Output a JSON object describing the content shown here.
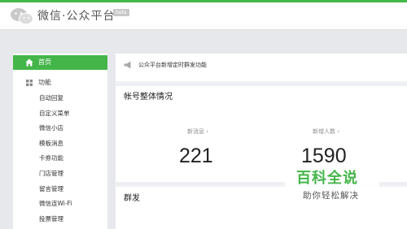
{
  "header": {
    "brand": "微信·公众平台",
    "beta": "beta"
  },
  "sidebar": {
    "home_label": "首页",
    "group_label": "功能",
    "items": [
      {
        "label": "自动回复"
      },
      {
        "label": "自定义菜单"
      },
      {
        "label": "微信小店"
      },
      {
        "label": "模板消息"
      },
      {
        "label": "卡券功能"
      },
      {
        "label": "门店管理"
      },
      {
        "label": "留言管理"
      },
      {
        "label": "微信连Wi-Fi"
      },
      {
        "label": "投票管理"
      }
    ]
  },
  "main": {
    "notice": "公众平台新增定时群发功能",
    "account_section_title": "帐号整体情况",
    "stats": [
      {
        "label": "新消息",
        "value": "221"
      },
      {
        "label": "新增人数",
        "value": "1590"
      }
    ],
    "broadcast_section_title": "群发"
  },
  "watermark": {
    "title": "百科全说",
    "subtitle": "助你轻松解决"
  },
  "colors": {
    "accent": "#44b549",
    "background": "#e7e8eb"
  }
}
